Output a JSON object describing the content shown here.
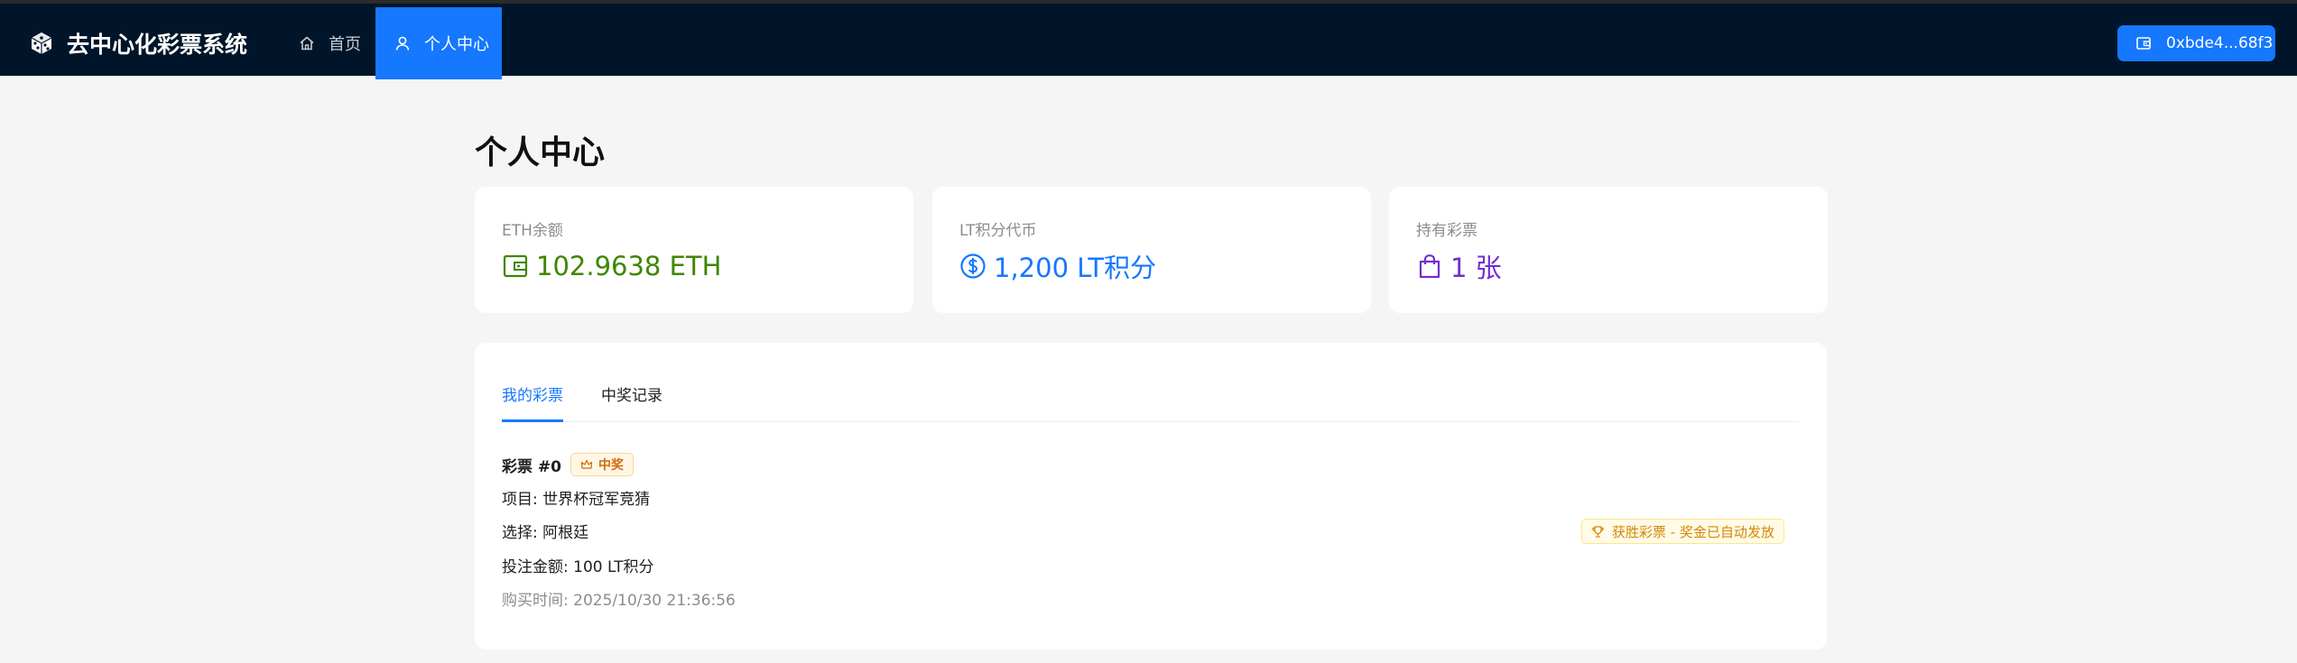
{
  "app": {
    "title": "去中心化彩票系统",
    "logo_icon": "dice-icon"
  },
  "nav": {
    "items": [
      {
        "label": "首页",
        "icon": "home-icon",
        "active": false
      },
      {
        "label": "个人中心",
        "icon": "user-icon",
        "active": true
      }
    ]
  },
  "wallet": {
    "address": "0xbde4...68f3",
    "icon": "wallet-icon"
  },
  "page": {
    "title": "个人中心"
  },
  "stats": [
    {
      "label": "ETH余额",
      "value": "102.9638 ETH",
      "icon": "wallet-icon",
      "color": "#3f8600"
    },
    {
      "label": "LT积分代币",
      "value": "1,200 LT积分",
      "icon": "dollar-circle-icon",
      "color": "#1677ff"
    },
    {
      "label": "持有彩票",
      "value": "1 张",
      "icon": "shopping-bag-icon",
      "color": "#722ed1"
    }
  ],
  "tabs": [
    {
      "label": "我的彩票",
      "active": true
    },
    {
      "label": "中奖记录",
      "active": false
    }
  ],
  "tickets": [
    {
      "title": "彩票 #0",
      "status_tag": "中奖",
      "status_icon": "crown-icon",
      "project": "项目: 世界杯冠军竞猜",
      "choice": "选择: 阿根廷",
      "amount": "投注金额: 100 LT积分",
      "purchase_time": "购买时间: 2025/10/30 21:36:56",
      "result_tag": "获胜彩票 - 奖金已自动发放",
      "result_icon": "trophy-icon"
    }
  ]
}
